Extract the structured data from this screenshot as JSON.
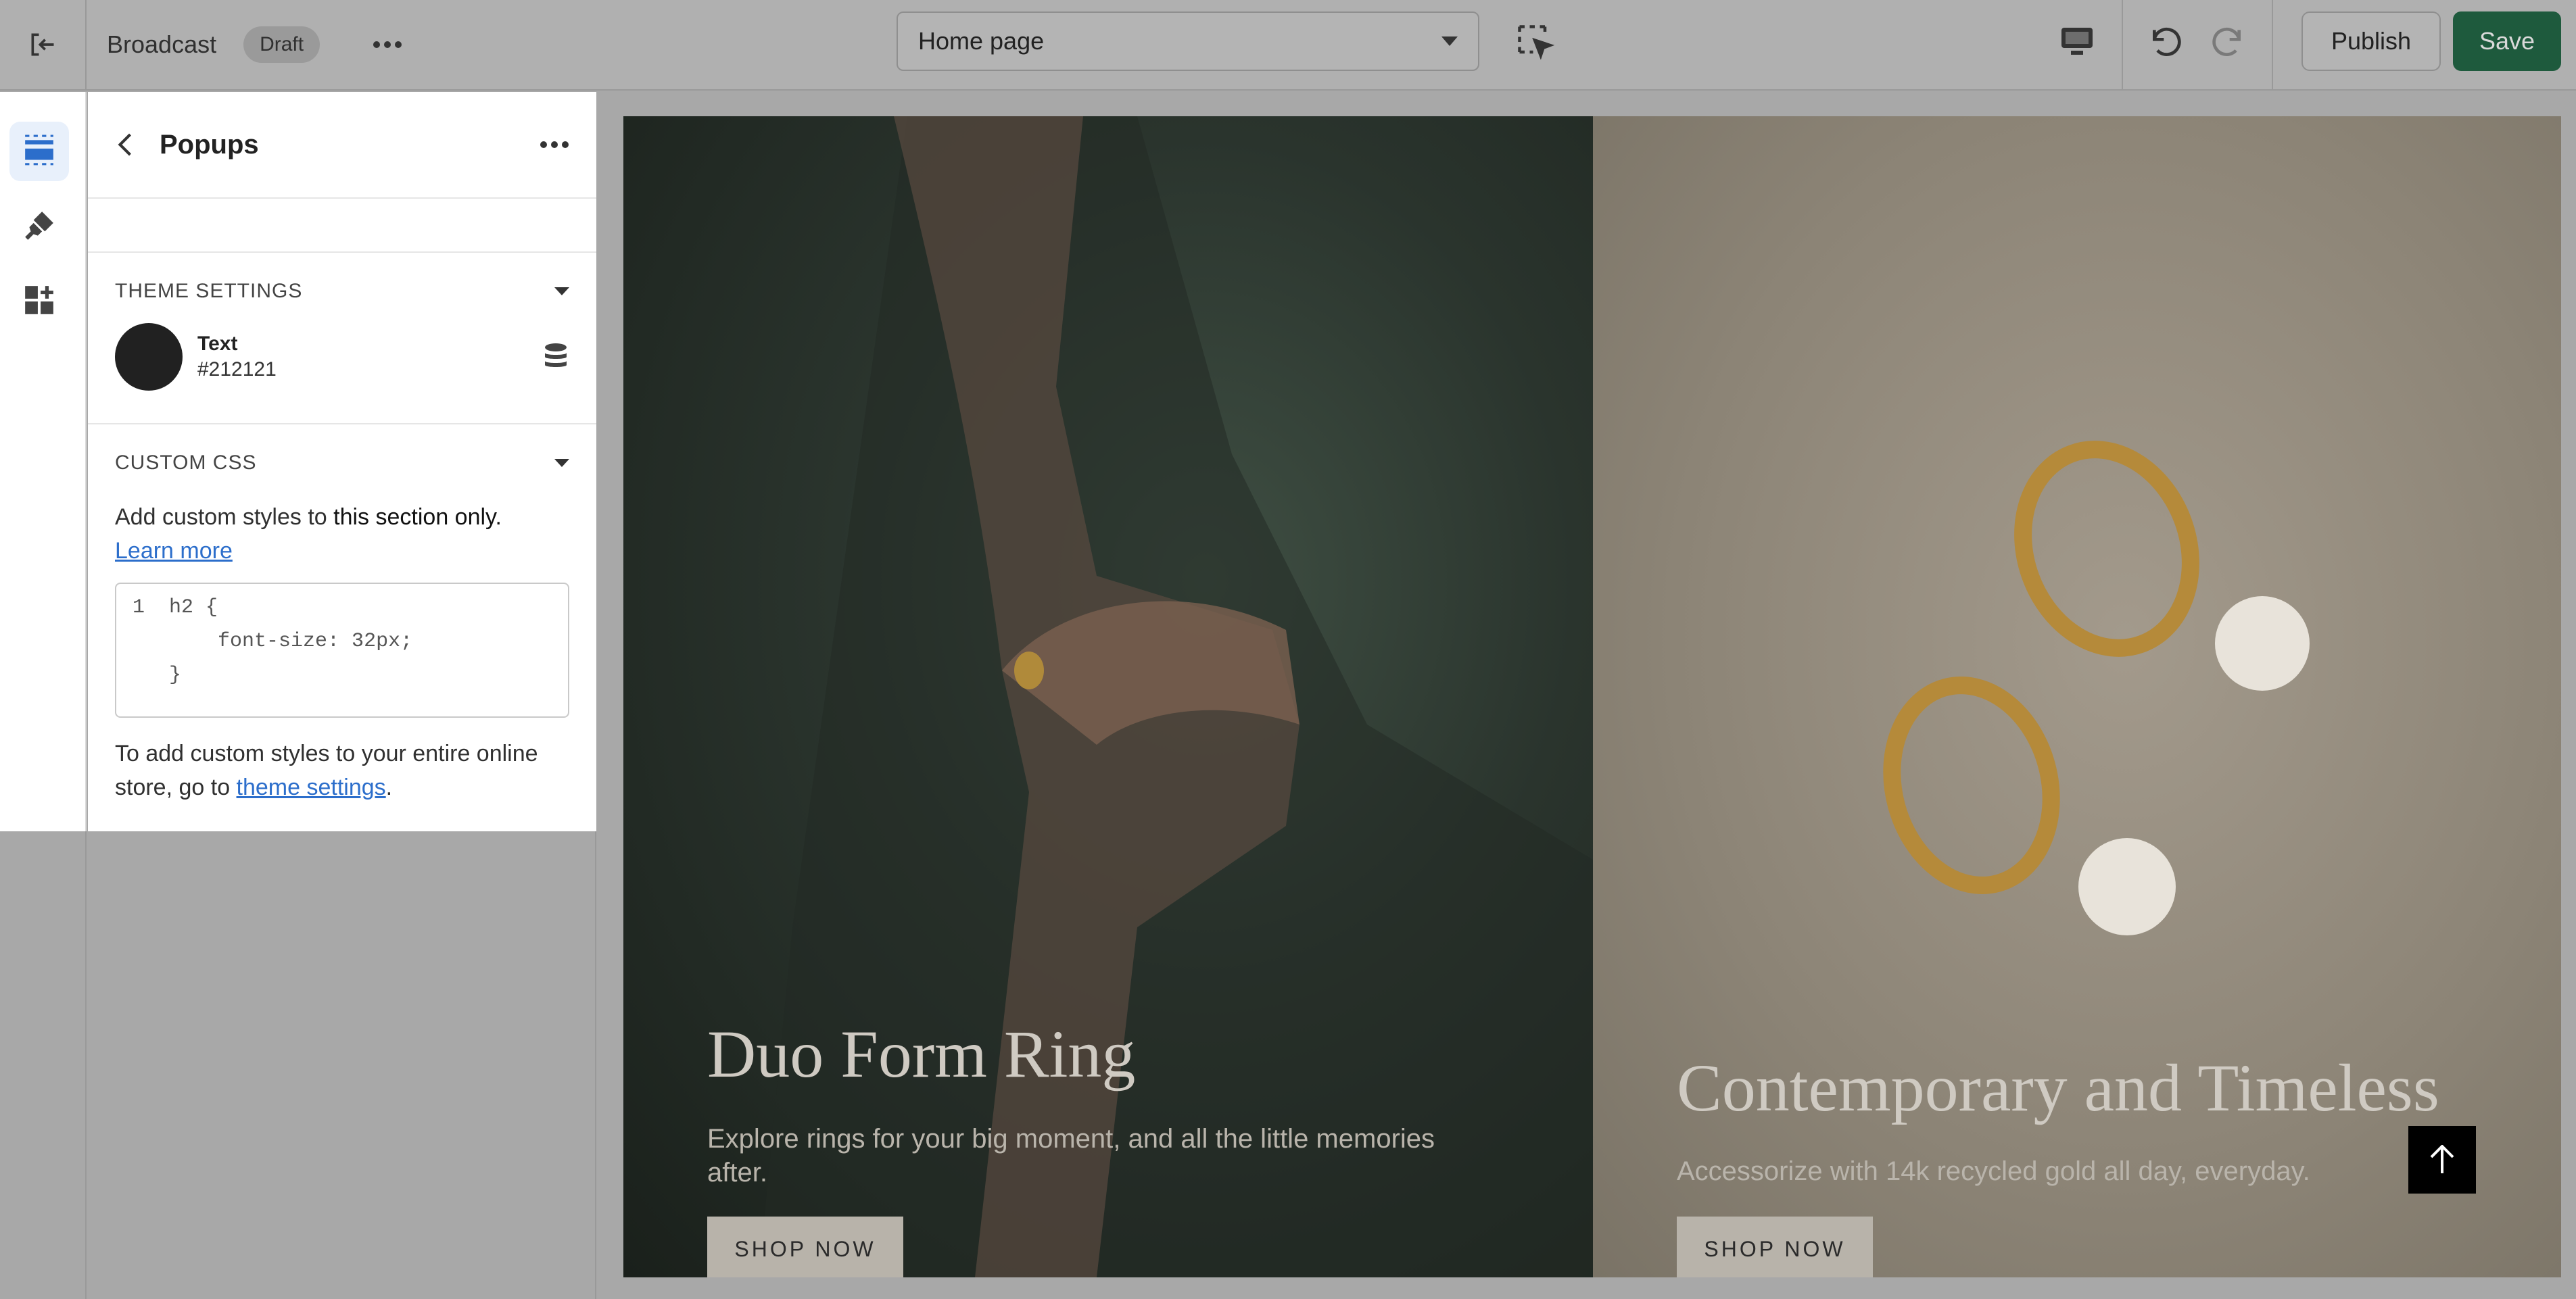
{
  "topbar": {
    "store_name": "Broadcast",
    "status_badge": "Draft",
    "page_selector": "Home page",
    "publish_label": "Publish",
    "save_label": "Save"
  },
  "sidebar_rail": {
    "items": [
      {
        "icon": "sections-icon",
        "active": true
      },
      {
        "icon": "theme-settings-icon",
        "active": false
      },
      {
        "icon": "apps-icon",
        "active": false
      }
    ]
  },
  "panel": {
    "title": "Popups",
    "theme_settings": {
      "heading": "THEME SETTINGS",
      "color_label": "Text",
      "color_value": "#212121"
    },
    "custom_css": {
      "heading": "CUSTOM CSS",
      "help_prefix": "Add custom styles to ",
      "help_bold": "this section only.",
      "learn_more": "Learn more",
      "code_lines": [
        "h2 {",
        "    font-size: 32px;",
        "}"
      ],
      "line_number": "1",
      "footer_prefix": "To add custom styles to your entire online store, go to ",
      "footer_link": "theme settings",
      "footer_suffix": "."
    }
  },
  "preview": {
    "left": {
      "title": "Duo Form Ring",
      "subtitle": "Explore rings for your big moment, and all the little memories after.",
      "button": "SHOP NOW"
    },
    "right": {
      "title": "Contemporary and Timeless",
      "subtitle": "Accessorize with 14k recycled gold all day, everyday.",
      "button": "SHOP NOW"
    }
  },
  "colors": {
    "save_green": "#1e5a3d",
    "link_blue": "#2c6ecb",
    "swatch": "#212121"
  }
}
